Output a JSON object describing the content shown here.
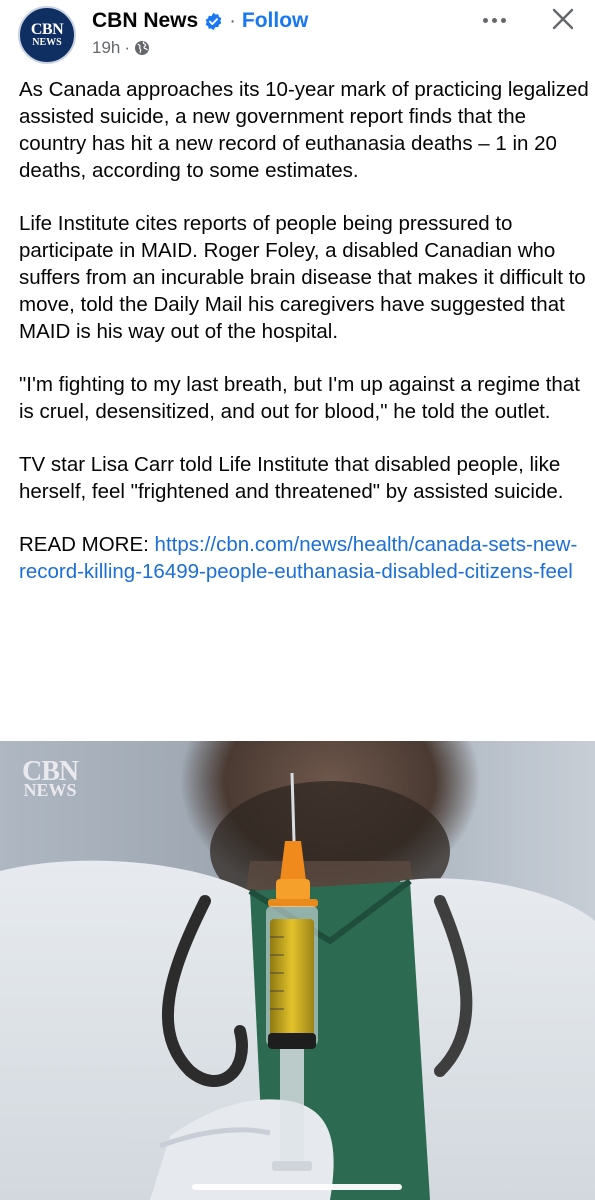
{
  "header": {
    "avatar_line1": "CBN",
    "avatar_line2": "NEWS",
    "page_name": "CBN News",
    "separator": "·",
    "follow_label": "Follow",
    "timestamp": "19h",
    "meta_separator": "·",
    "verified_icon": "verified-badge-icon",
    "audience_icon": "globe-icon",
    "more_icon": "more-options-icon",
    "close_icon": "close-icon"
  },
  "post": {
    "p1": "As Canada approaches its 10-year mark of practicing legalized assisted suicide, a new government report finds that the country has hit a new record of euthanasia deaths – 1 in 20 deaths, according to some estimates.",
    "p2": "Life Institute cites reports of people being pressured to participate in MAID. Roger Foley, a disabled Canadian who suffers from an incurable brain disease that makes it difficult to move, told the Daily Mail his caregivers have suggested that MAID is his way out of the hospital.",
    "p3": "\"I'm fighting to my last breath, but I'm up against a regime that is cruel, desensitized, and out for blood,\" he told the outlet.",
    "p4": "TV star Lisa Carr told Life Institute that disabled people, like herself, feel \"frightened and threatened\" by assisted suicide.",
    "read_more_label": "READ MORE: ",
    "link_text": "https://cbn.com/news/health/canada-sets-new-record-killing-16499-people-euthanasia-disabled-citizens-feel"
  },
  "media": {
    "watermark_line1": "CBN",
    "watermark_line2": "NEWS"
  },
  "colors": {
    "link": "#1b6fd6",
    "follow": "#1877f2",
    "verified": "#1877f2",
    "muted": "#65676b"
  }
}
